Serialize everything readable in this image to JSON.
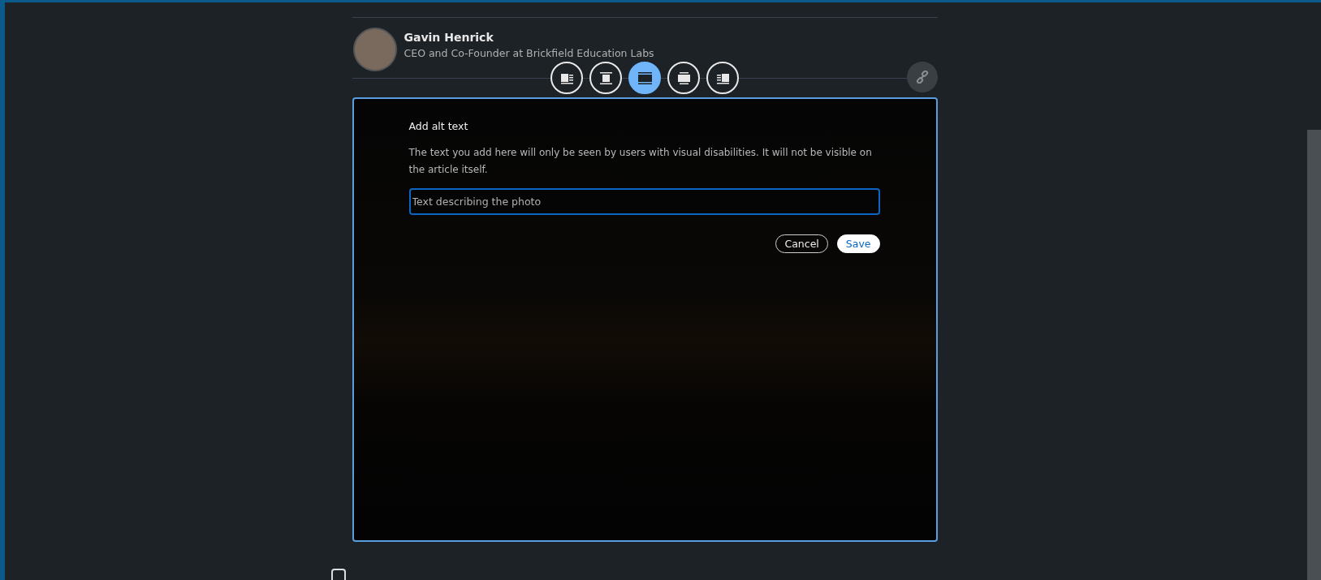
{
  "author": {
    "name": "Gavin Henrick",
    "headline": "CEO and Co-Founder at Brickfield Education Labs"
  },
  "layout_options": [
    {
      "kind": "wrap-left",
      "selected": false
    },
    {
      "kind": "center",
      "selected": false
    },
    {
      "kind": "full",
      "selected": true
    },
    {
      "kind": "wide",
      "selected": false
    },
    {
      "kind": "wrap-right",
      "selected": false
    }
  ],
  "alt_text_dialog": {
    "title": "Add alt text",
    "description": "The text you add here will only be seen by users with visual disabilities. It will not be visible on the article itself.",
    "placeholder": "Text describing the photo",
    "buttons": [
      {
        "kind": "secondary",
        "label": "Cancel"
      },
      {
        "kind": "primary",
        "label": "Save"
      }
    ]
  }
}
